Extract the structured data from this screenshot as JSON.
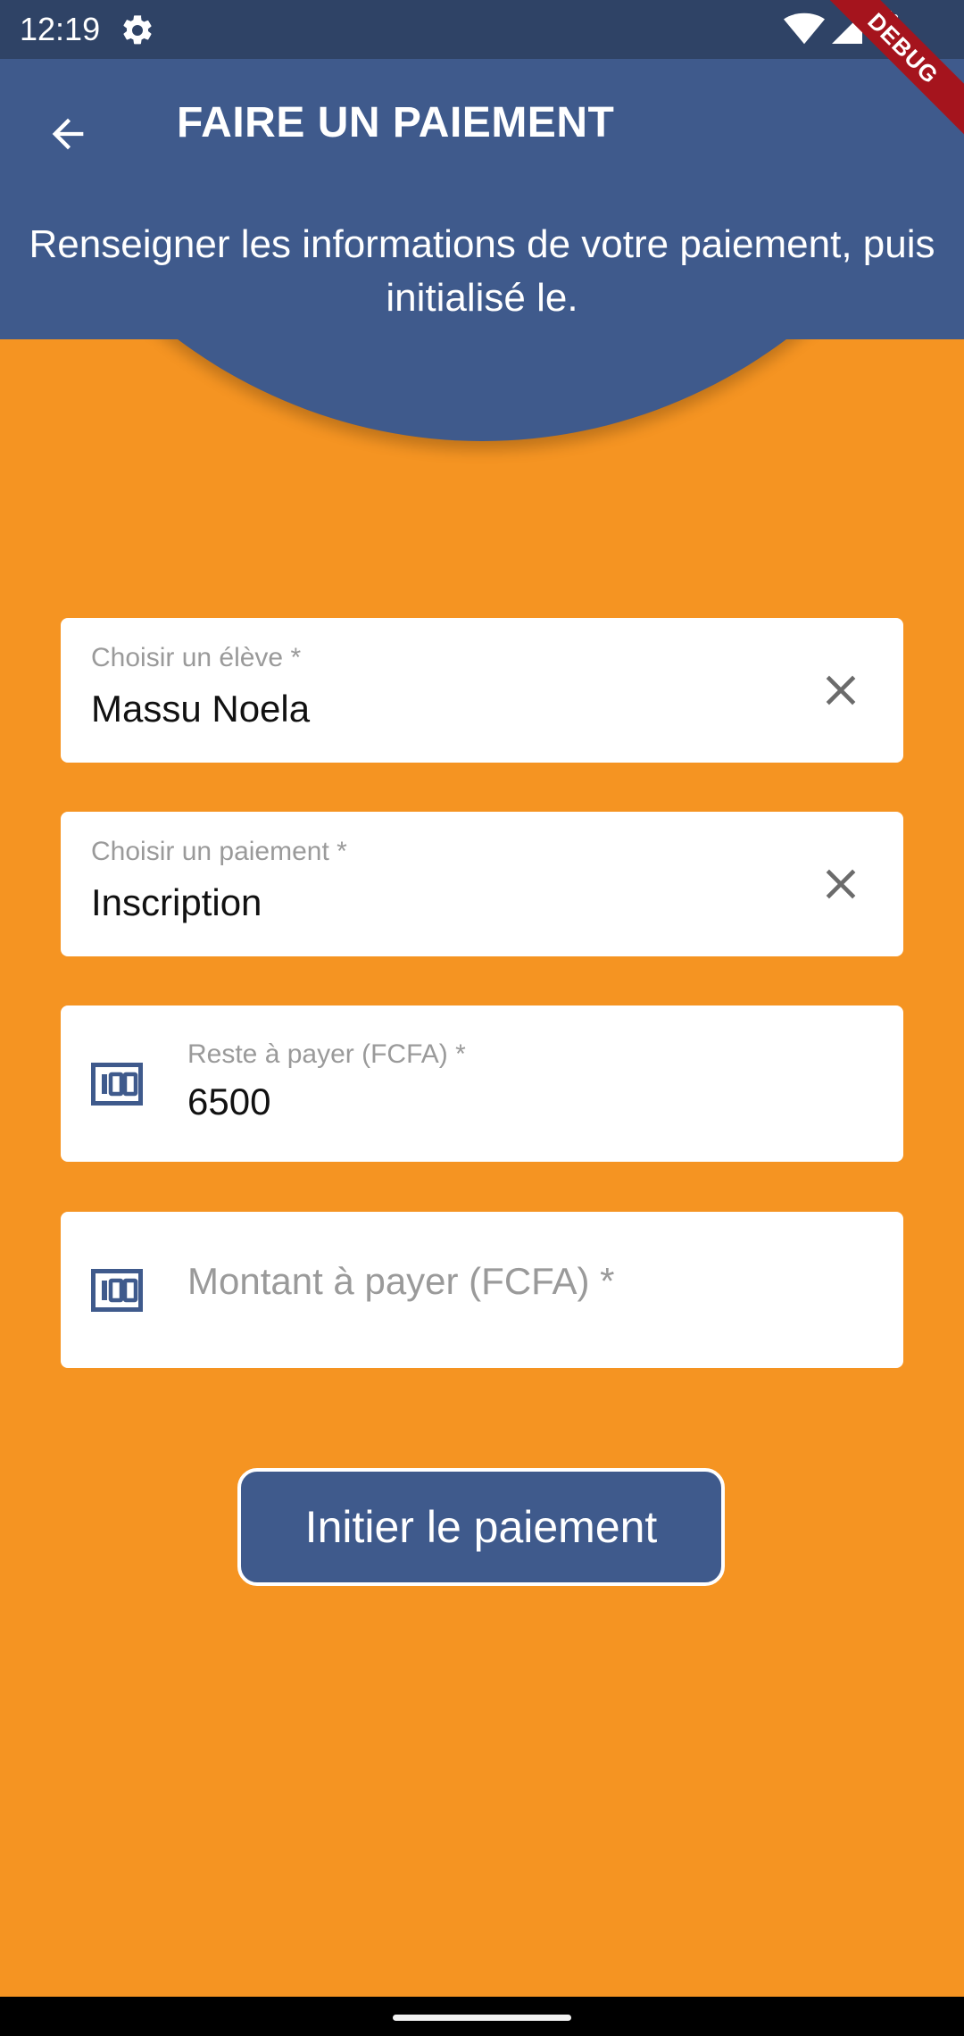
{
  "status_bar": {
    "time": "12:19",
    "icons": [
      "gear-icon",
      "wifi-icon",
      "signal-icon",
      "battery-icon"
    ]
  },
  "debug_banner": "DEBUG",
  "app_bar": {
    "title": "FAIRE UN PAIEMENT",
    "back_icon": "arrow-back-icon"
  },
  "subtitle": "Renseigner les informations de votre paiement, puis initialisé le.",
  "form": {
    "student": {
      "label": "Choisir un élève *",
      "value": "Massu Noela",
      "clear_icon": "close-icon"
    },
    "payment": {
      "label": "Choisir un paiement *",
      "value": "Inscription",
      "clear_icon": "close-icon"
    },
    "remaining": {
      "label": "Reste à payer (FCFA) *",
      "value": "6500",
      "icon": "money-icon"
    },
    "amount": {
      "placeholder": "Montant à payer (FCFA) *",
      "value": "",
      "icon": "money-icon"
    }
  },
  "submit_label": "Initier le paiement",
  "colors": {
    "primary": "#3f5a8c",
    "status_bar": "#2f4366",
    "background": "#f59422",
    "debug": "#a5141d"
  }
}
